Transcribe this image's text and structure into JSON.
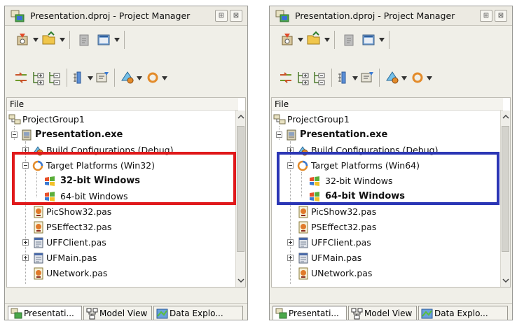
{
  "panels": [
    {
      "title": "Presentation.dproj - Project Manager",
      "win_buttons": {
        "pin": "⊞",
        "close": "⊠"
      },
      "tree_header": "File",
      "rows": [
        {
          "label": "ProjectGroup1",
          "bold": false,
          "icon": "project-group-icon"
        },
        {
          "label": "Presentation.exe",
          "bold": true,
          "icon": "exe-project-icon"
        },
        {
          "label": "Build Configurations (Debug)",
          "bold": false,
          "icon": "build-config-icon"
        },
        {
          "label": "Target Platforms (Win32)",
          "bold": false,
          "icon": "target-platform-icon"
        },
        {
          "label": "32-bit Windows",
          "bold": true,
          "icon": "windows-platform-icon"
        },
        {
          "label": "64-bit Windows",
          "bold": false,
          "icon": "windows-platform-icon"
        },
        {
          "label": "PicShow32.pas",
          "bold": false,
          "icon": "pascal-unit-icon"
        },
        {
          "label": "PSEffect32.pas",
          "bold": false,
          "icon": "pascal-unit-icon"
        },
        {
          "label": "UFFClient.pas",
          "bold": false,
          "icon": "form-unit-icon"
        },
        {
          "label": "UFMain.pas",
          "bold": false,
          "icon": "form-unit-icon"
        },
        {
          "label": "UNetwork.pas",
          "bold": false,
          "icon": "pascal-unit-icon"
        }
      ],
      "highlight_color": "#e0191b",
      "tabs": [
        "Presentati...",
        "Model View",
        "Data Explo..."
      ]
    },
    {
      "title": "Presentation.dproj - Project Manager",
      "win_buttons": {
        "pin": "⊞",
        "close": "⊠"
      },
      "tree_header": "File",
      "rows": [
        {
          "label": "ProjectGroup1",
          "bold": false,
          "icon": "project-group-icon"
        },
        {
          "label": "Presentation.exe",
          "bold": true,
          "icon": "exe-project-icon"
        },
        {
          "label": "Build Configurations (Debug)",
          "bold": false,
          "icon": "build-config-icon"
        },
        {
          "label": "Target Platforms (Win64)",
          "bold": false,
          "icon": "target-platform-icon"
        },
        {
          "label": "32-bit Windows",
          "bold": false,
          "icon": "windows-platform-icon"
        },
        {
          "label": "64-bit Windows",
          "bold": true,
          "icon": "windows-platform-icon"
        },
        {
          "label": "PicShow32.pas",
          "bold": false,
          "icon": "pascal-unit-icon"
        },
        {
          "label": "PSEffect32.pas",
          "bold": false,
          "icon": "pascal-unit-icon"
        },
        {
          "label": "UFFClient.pas",
          "bold": false,
          "icon": "form-unit-icon"
        },
        {
          "label": "UFMain.pas",
          "bold": false,
          "icon": "form-unit-icon"
        },
        {
          "label": "UNetwork.pas",
          "bold": false,
          "icon": "pascal-unit-icon"
        }
      ],
      "highlight_color": "#2b36b5",
      "tabs": [
        "Presentati...",
        "Model View",
        "Data Explo..."
      ]
    }
  ]
}
